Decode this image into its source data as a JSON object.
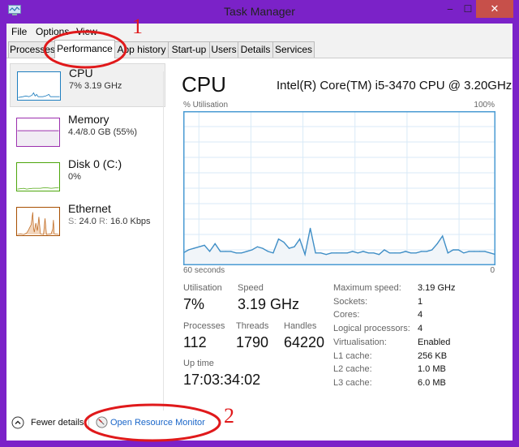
{
  "window": {
    "title": "Task Manager",
    "minimize_glyph": "‒",
    "maximize_glyph": "☐",
    "close_glyph": "✕"
  },
  "menu": [
    "File",
    "Options",
    "View"
  ],
  "tabs": [
    {
      "label": "Processes",
      "active": false
    },
    {
      "label": "Performance",
      "active": true
    },
    {
      "label": "App history",
      "active": false
    },
    {
      "label": "Start-up",
      "active": false
    },
    {
      "label": "Users",
      "active": false
    },
    {
      "label": "Details",
      "active": false
    },
    {
      "label": "Services",
      "active": false
    }
  ],
  "sidebar": [
    {
      "name": "CPU",
      "sub": "7% 3.19 GHz",
      "color": "#1e7ebf",
      "selected": true
    },
    {
      "name": "Memory",
      "sub": "4.4/8.0 GB (55%)",
      "color": "#9b2fae",
      "selected": false
    },
    {
      "name": "Disk 0 (C:)",
      "sub": "0%",
      "color": "#4da60c",
      "selected": false
    },
    {
      "name": "Ethernet",
      "sub_send_label": "S:",
      "sub_send": "24.0",
      "sub_recv_label": "R:",
      "sub_recv": "16.0 Kbps",
      "color": "#a74f01",
      "selected": false
    }
  ],
  "main": {
    "title": "CPU",
    "model": "Intel(R) Core(TM) i5-3470 CPU @ 3.20GHz",
    "y_label": "% Utilisation",
    "y_max_label": "100%",
    "x_left_label": "60 seconds",
    "x_right_label": "0",
    "stats": {
      "utilisation_label": "Utilisation",
      "utilisation": "7%",
      "speed_label": "Speed",
      "speed": "3.19 GHz",
      "processes_label": "Processes",
      "processes": "112",
      "threads_label": "Threads",
      "threads": "1790",
      "handles_label": "Handles",
      "handles": "64220",
      "uptime_label": "Up time",
      "uptime": "17:03:34:02"
    },
    "details": [
      {
        "k": "Maximum speed:",
        "v": "3.19 GHz"
      },
      {
        "k": "Sockets:",
        "v": "1"
      },
      {
        "k": "Cores:",
        "v": "4"
      },
      {
        "k": "Logical processors:",
        "v": "4"
      },
      {
        "k": "Virtualisation:",
        "v": "Enabled"
      },
      {
        "k": "L1 cache:",
        "v": "256 KB"
      },
      {
        "k": "L2 cache:",
        "v": "1.0 MB"
      },
      {
        "k": "L3 cache:",
        "v": "6.0 MB"
      }
    ]
  },
  "footer": {
    "fewer_details": "Fewer details",
    "resource_monitor": "Open Resource Monitor"
  },
  "annotations": {
    "one": "1",
    "two": "2"
  },
  "chart_data": {
    "type": "area",
    "title": "% Utilisation",
    "xlabel": "60 seconds",
    "ylabel": "% Utilisation",
    "ylim": [
      0,
      100
    ],
    "xlim": [
      60,
      0
    ],
    "grid": true,
    "values": [
      8,
      10,
      11,
      12,
      13,
      9,
      14,
      9,
      9,
      9,
      8,
      8,
      9,
      10,
      12,
      11,
      9,
      8,
      17,
      15,
      11,
      12,
      17,
      7,
      24,
      8,
      8,
      7,
      8,
      8,
      8,
      8,
      9,
      8,
      9,
      8,
      8,
      7,
      10,
      8,
      8,
      8,
      9,
      8,
      8,
      9,
      9,
      10,
      14,
      19,
      8,
      10,
      10,
      8,
      9,
      9,
      9,
      9,
      8,
      7
    ]
  }
}
